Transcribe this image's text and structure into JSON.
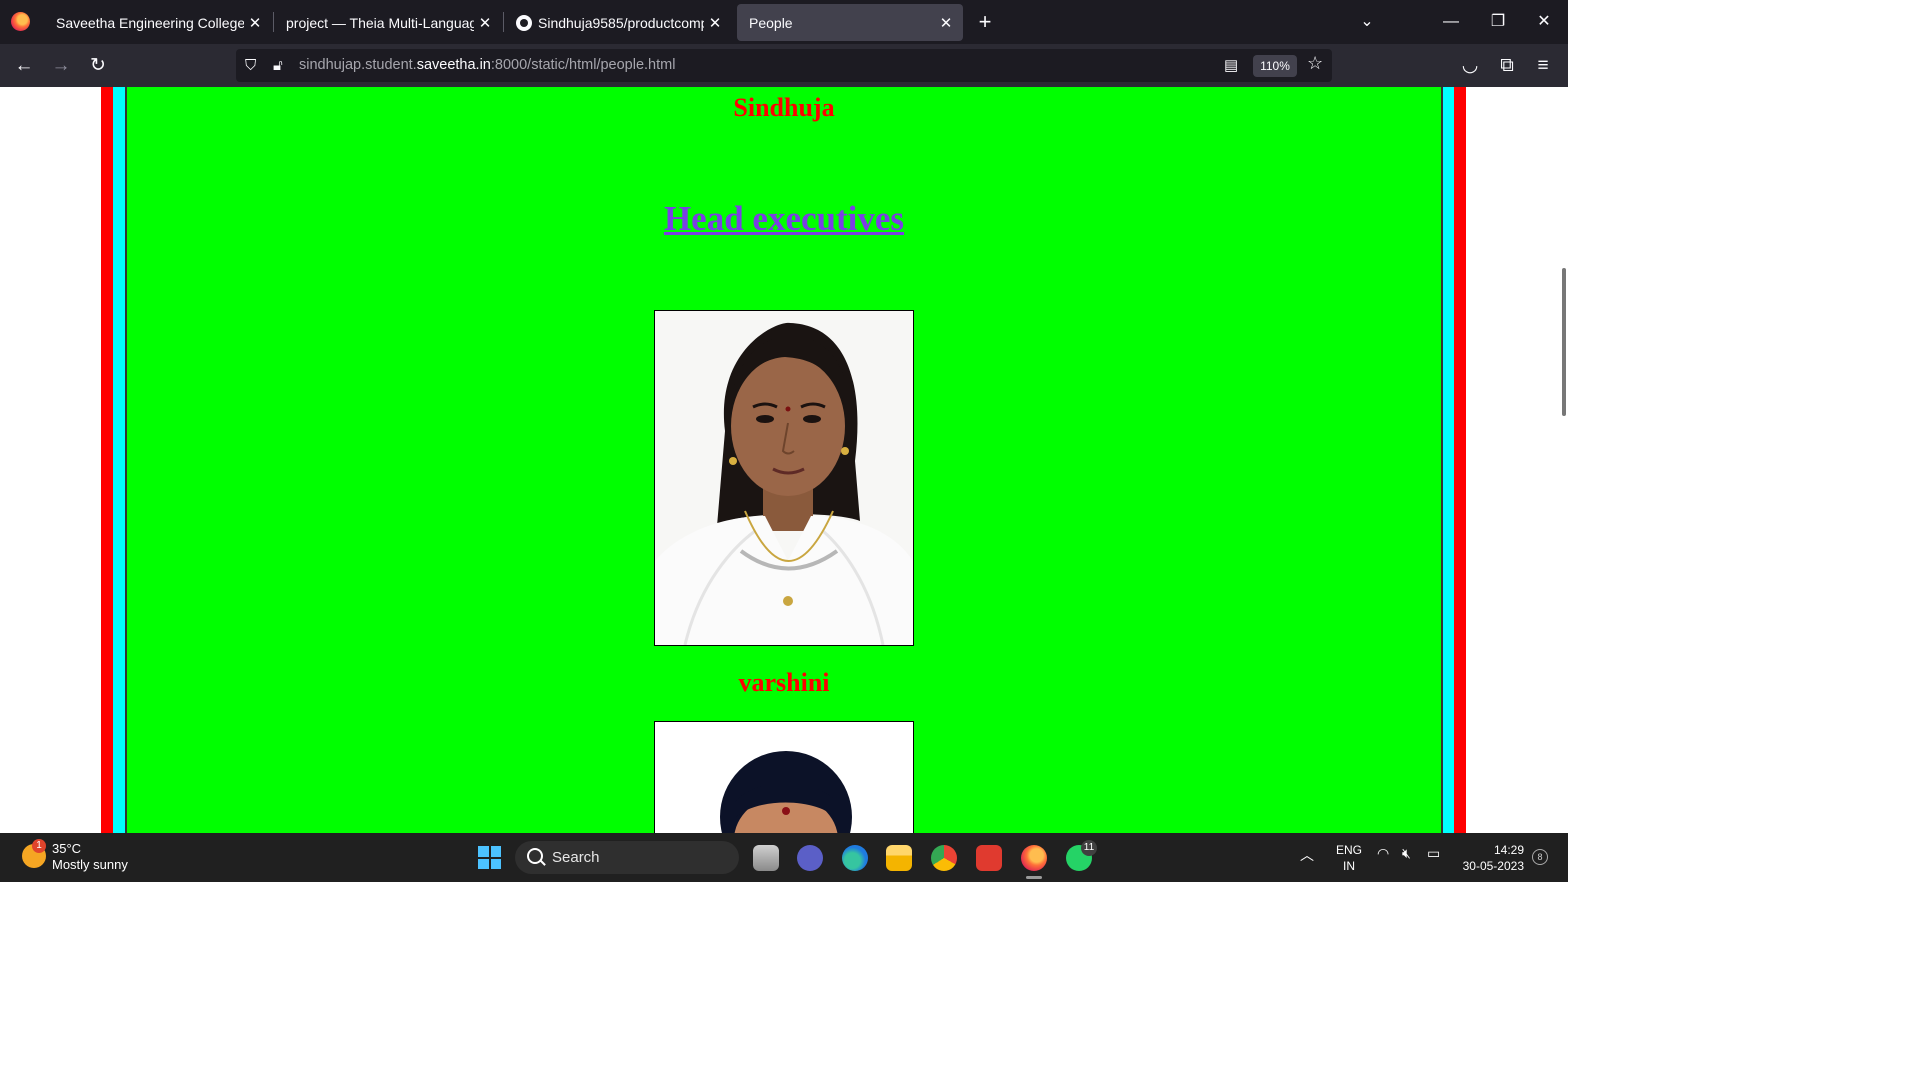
{
  "browser": {
    "tabs": [
      {
        "label": "Saveetha Engineering College",
        "active": false
      },
      {
        "label": "project — Theia Multi-Language Ex",
        "active": false
      },
      {
        "label": "Sindhuja9585/productcompany",
        "active": false
      },
      {
        "label": "People",
        "active": true
      }
    ],
    "url": {
      "prefix": "sindhujap.student.",
      "host": "saveetha.in",
      "suffix": ":8000/static/html/people.html"
    },
    "zoom": "110%"
  },
  "page": {
    "top_name": "Sindhuja",
    "section_title": "Head executives",
    "person_name": "varshini",
    "colors": {
      "background": "#00ff00",
      "outer_border": "#ff0000",
      "inner_border": "#00ffff",
      "name_color": "#ff0000",
      "link_color": "#7b3fe4"
    }
  },
  "taskbar": {
    "weather_temp": "35°C",
    "weather_desc": "Mostly sunny",
    "weather_badge": "1",
    "search_label": "Search",
    "whatsapp_badge": "11",
    "lang_line1": "ENG",
    "lang_line2": "IN",
    "time": "14:29",
    "date": "30-05-2023",
    "notifications": "8"
  }
}
